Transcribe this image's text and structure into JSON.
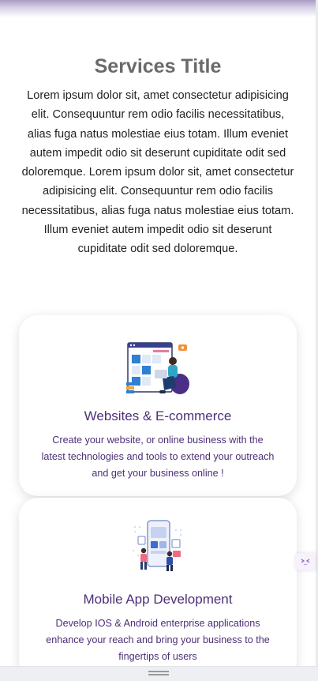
{
  "services": {
    "title": "Services Title",
    "description": "Lorem ipsum dolor sit, amet consectetur adipisicing elit. Consequuntur rem odio facilis necessitatibus, alias fuga natus molestiae eius totam. Illum eveniet autem impedit odio sit deserunt cupiditate odit sed doloremque. Lorem ipsum dolor sit, amet consectetur adipisicing elit. Consequuntur rem odio facilis necessitatibus, alias fuga natus molestiae eius totam. Illum eveniet autem impedit odio sit deserunt cupiditate odit sed doloremque."
  },
  "cards": [
    {
      "title": "Websites & E-commerce",
      "description": "Create your website, or online business with the latest technologies and tools to extend your outreach and get your business online !",
      "icon": "website-ecommerce-illustration"
    },
    {
      "title": "Mobile App Development",
      "description": "Develop IOS & Android enterprise applications enhance your reach and bring your business to the fingertips of users",
      "icon": "mobile-app-illustration"
    }
  ],
  "colors": {
    "accent": "#4c2f78",
    "title_gray": "#6a6a6a",
    "header_gradient": "#a99bc6"
  }
}
